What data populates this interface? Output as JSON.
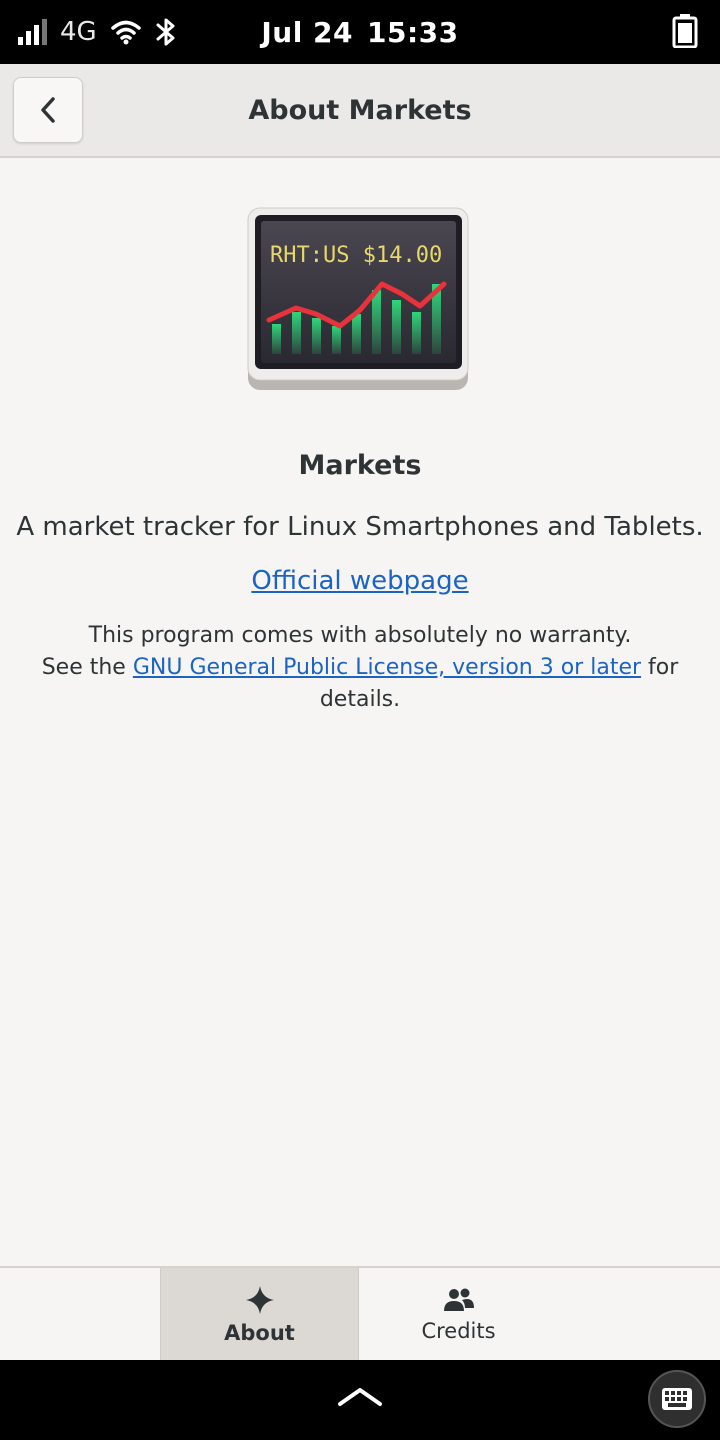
{
  "status_bar": {
    "network": "4G",
    "date": "Jul 24",
    "time": "15:33"
  },
  "header": {
    "title": "About Markets"
  },
  "app": {
    "icon_ticker_text": "RHT:US $14.00",
    "name": "Markets",
    "description": "A market tracker for Linux Smartphones and Tablets.",
    "website_label": "Official webpage",
    "license_line1": "This program comes with absolutely no warranty.",
    "license_prefix": "See the ",
    "license_link": "GNU General Public License, version 3 or later",
    "license_suffix": " for details."
  },
  "view_switcher": {
    "tabs": [
      {
        "label": "About",
        "icon": "sparkle-icon",
        "active": true
      },
      {
        "label": "Credits",
        "icon": "people-icon",
        "active": false
      }
    ]
  },
  "colors": {
    "link": "#1c64c4",
    "accent_red": "#e8323c",
    "accent_green": "#2ed67a",
    "ticker_yellow": "#e8d76a"
  }
}
